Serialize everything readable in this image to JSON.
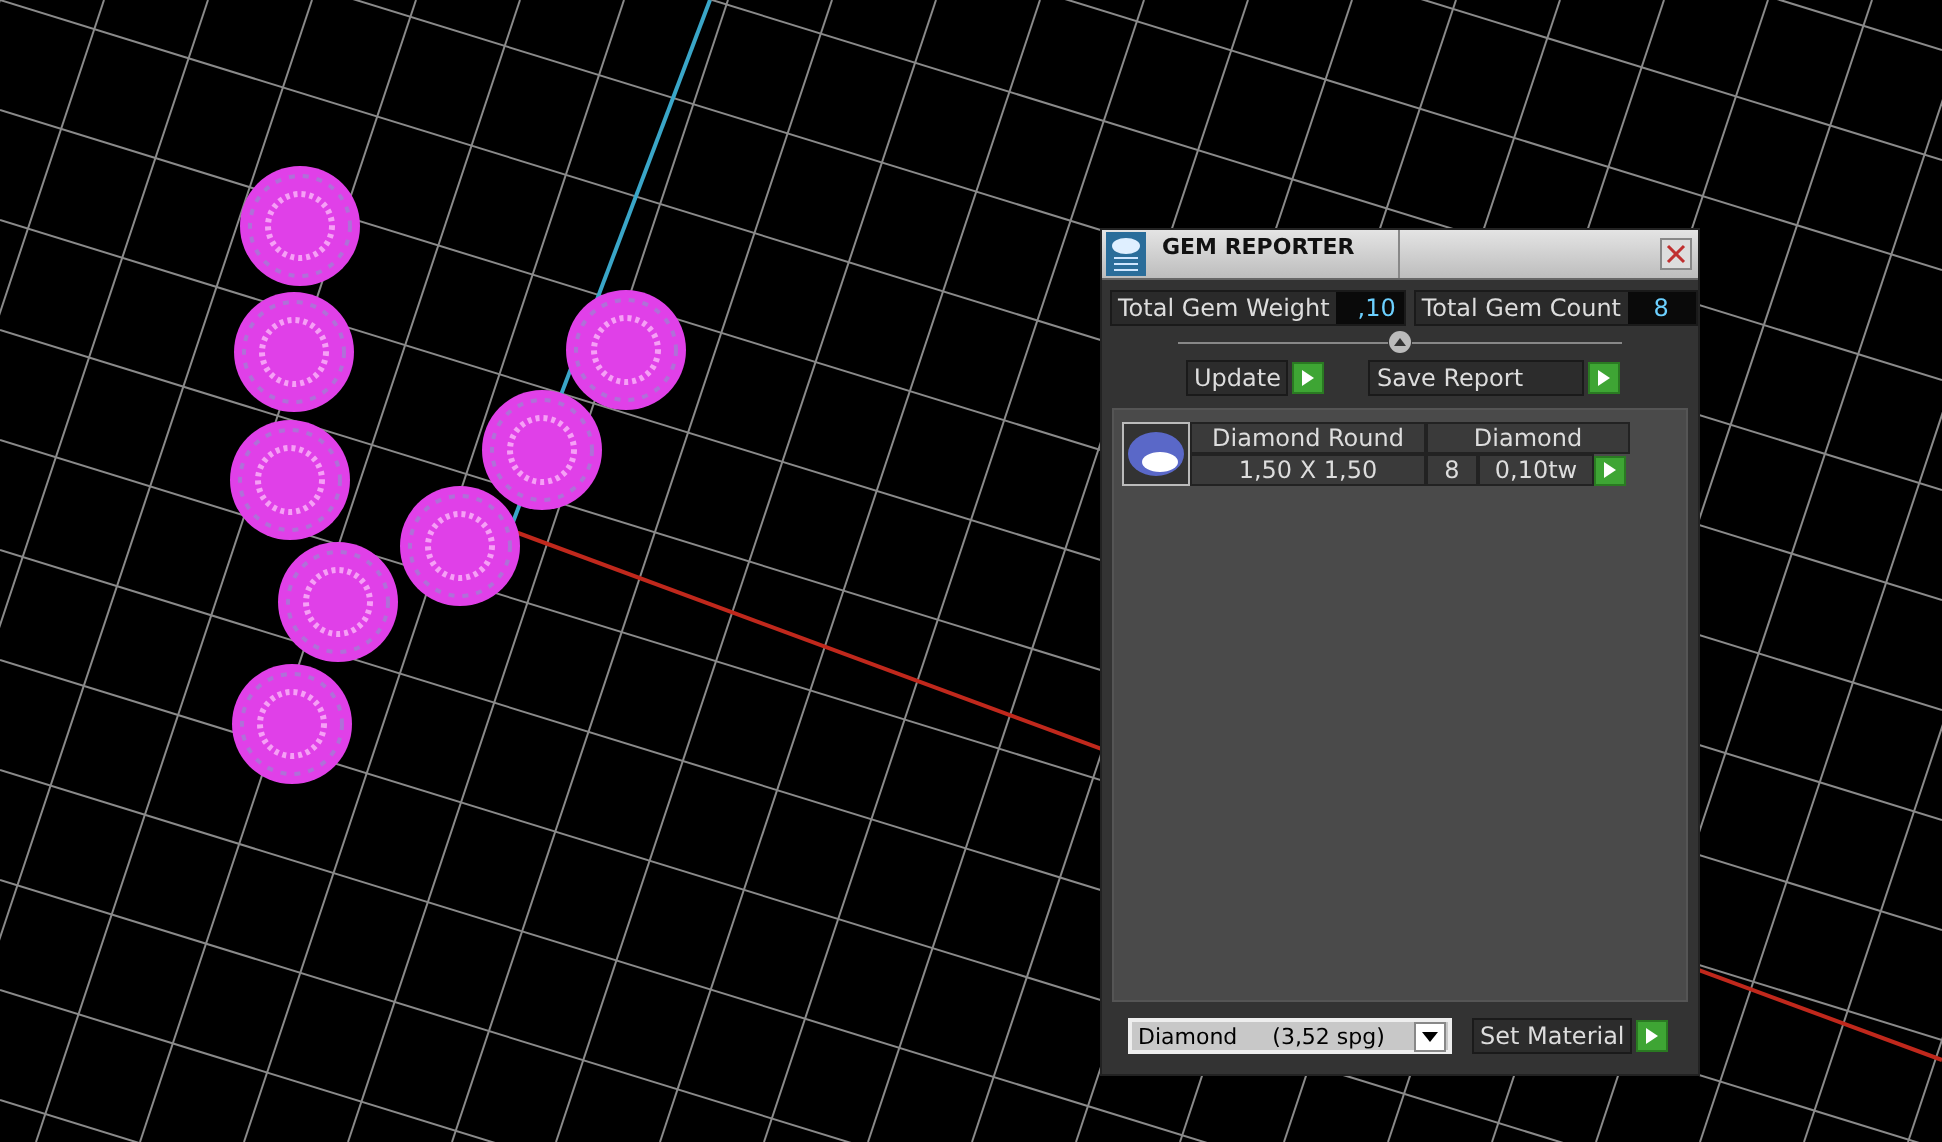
{
  "window": {
    "title": "GEM REPORTER"
  },
  "totals": [
    {
      "label": "Total Gem Weight",
      "value": ",10"
    },
    {
      "label": "Total Gem Count",
      "value": "8"
    }
  ],
  "buttons": [
    {
      "label": "Update"
    },
    {
      "label": "Save Report"
    }
  ],
  "gems": [
    {
      "name": "Diamond Round",
      "material": "Diamond",
      "size": "1,50 X 1,50",
      "count": "8",
      "weight": "0,10tw"
    }
  ],
  "material_select": {
    "value": "Diamond     (3,52 spg)"
  },
  "set_material_button": {
    "label": "Set Material"
  }
}
